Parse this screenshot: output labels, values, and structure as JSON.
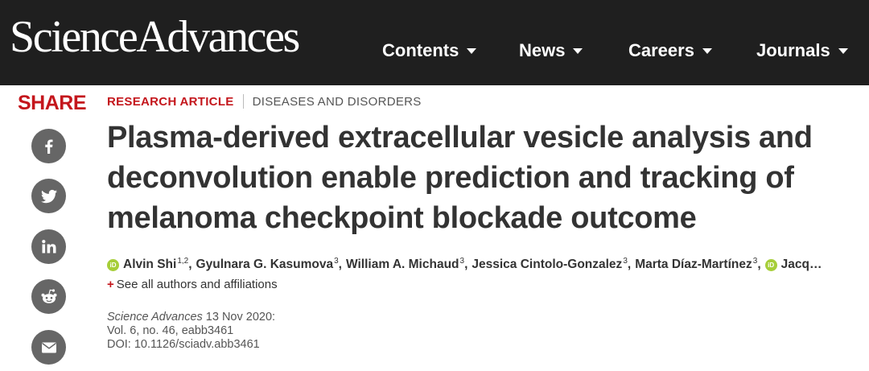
{
  "header": {
    "logo": "ScienceAdvances",
    "nav": [
      {
        "label": "Contents"
      },
      {
        "label": "News"
      },
      {
        "label": "Careers"
      },
      {
        "label": "Journals"
      }
    ]
  },
  "share": {
    "label": "SHARE",
    "buttons": [
      "facebook-icon",
      "twitter-icon",
      "linkedin-icon",
      "reddit-icon",
      "email-icon"
    ]
  },
  "article": {
    "type": "RESEARCH ARTICLE",
    "subject": "DISEASES AND DISORDERS",
    "title": "Plasma-derived extracellular vesicle analysis and deconvolution enable prediction and tracking of melanoma checkpoint blockade outcome",
    "authors": [
      {
        "name": "Alvin Shi",
        "sup": "1,2",
        "orcid": true
      },
      {
        "name": "Gyulnara G. Kasumova",
        "sup": "3",
        "orcid": false
      },
      {
        "name": "William A. Michaud",
        "sup": "3",
        "orcid": false
      },
      {
        "name": "Jessica Cintolo-Gonzalez",
        "sup": "3",
        "orcid": false
      },
      {
        "name": "Marta Díaz-Martínez",
        "sup": "3",
        "orcid": false
      },
      {
        "name": "Jacq…",
        "sup": "",
        "orcid": true
      }
    ],
    "orcid_badge": "iD",
    "see_all": "See all authors and affiliations",
    "citation": {
      "journal": "Science Advances",
      "date": "13 Nov 2020:",
      "volume": "Vol. 6, no. 46, eabb3461",
      "doi": "DOI: 10.1126/sciadv.abb3461"
    }
  },
  "colors": {
    "header_bg": "#1f1f1f",
    "accent_red": "#c4161c",
    "share_icon_bg": "#666666",
    "orcid_green": "#a6ce39"
  }
}
